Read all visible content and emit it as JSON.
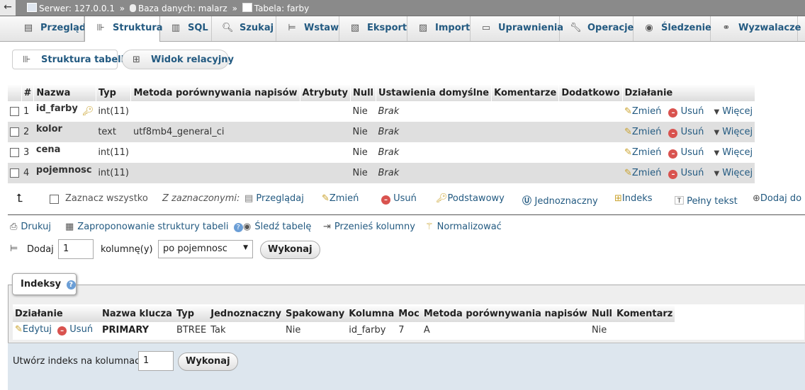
{
  "breadcrumb": {
    "server": "Serwer: 127.0.0.1",
    "database": "Baza danych: malarz",
    "table": "Tabela: farby",
    "sep": "»"
  },
  "tabs": [
    {
      "label": "Przeglądaj",
      "icon": "browse-icon"
    },
    {
      "label": "Struktura",
      "icon": "structure-icon"
    },
    {
      "label": "SQL",
      "icon": "sql-icon"
    },
    {
      "label": "Szukaj",
      "icon": "search-icon"
    },
    {
      "label": "Wstaw",
      "icon": "insert-icon"
    },
    {
      "label": "Eksport",
      "icon": "export-icon"
    },
    {
      "label": "Import",
      "icon": "import-icon"
    },
    {
      "label": "Uprawnienia",
      "icon": "privileges-icon"
    },
    {
      "label": "Operacje",
      "icon": "wrench-icon"
    },
    {
      "label": "Śledzenie",
      "icon": "eye-icon"
    },
    {
      "label": "Wyzwalacze",
      "icon": "triggers-icon"
    }
  ],
  "subtabs": {
    "structure": "Struktura tabeli",
    "relational": "Widok relacyjny"
  },
  "columns_table": {
    "headers": [
      "#",
      "Nazwa",
      "Typ",
      "Metoda porównywania napisów",
      "Atrybuty",
      "Null",
      "Ustawienia domyślne",
      "Komentarze",
      "Dodatkowo",
      "Działanie"
    ],
    "rows": [
      {
        "num": "1",
        "name": "id_farby",
        "type": "int(11)",
        "collation": "",
        "attributes": "",
        "null": "Nie",
        "default": "Brak",
        "comments": "",
        "extra": "",
        "primary": true
      },
      {
        "num": "2",
        "name": "kolor",
        "type": "text",
        "collation": "utf8mb4_general_ci",
        "attributes": "",
        "null": "Nie",
        "default": "Brak",
        "comments": "",
        "extra": "",
        "primary": false
      },
      {
        "num": "3",
        "name": "cena",
        "type": "int(11)",
        "collation": "",
        "attributes": "",
        "null": "Nie",
        "default": "Brak",
        "comments": "",
        "extra": "",
        "primary": false
      },
      {
        "num": "4",
        "name": "pojemnosc",
        "type": "int(11)",
        "collation": "",
        "attributes": "",
        "null": "Nie",
        "default": "Brak",
        "comments": "",
        "extra": "",
        "primary": false
      }
    ],
    "actions": {
      "change": "Zmień",
      "drop": "Usuń",
      "more": "Więcej"
    }
  },
  "selection_bar": {
    "check_all": "Zaznacz wszystko",
    "with_selected": "Z zaznaczonymi:",
    "browse": "Przeglądaj",
    "change": "Zmień",
    "drop": "Usuń",
    "primary": "Podstawowy",
    "unique": "Jednoznaczny",
    "index": "Indeks",
    "fulltext": "Pełny tekst",
    "add_to": "Dodaj do"
  },
  "tools": {
    "print": "Drukuj",
    "propose": "Zaproponowanie struktury tabeli",
    "track": "Śledź tabelę",
    "move": "Przenieś kolumny",
    "normalize": "Normalizować"
  },
  "add_columns": {
    "label": "Dodaj",
    "count": "1",
    "unit": "kolumnę(y)",
    "position": "po pojemnosc",
    "go": "Wykonaj"
  },
  "indexes": {
    "legend": "Indeksy",
    "headers": [
      "Działanie",
      "Nazwa klucza",
      "Typ",
      "Jednoznaczny",
      "Spakowany",
      "Kolumna",
      "Moc",
      "Metoda porównywania napisów",
      "Null",
      "Komentarz"
    ],
    "rows": [
      {
        "edit": "Edytuj",
        "drop": "Usuń",
        "key": "PRIMARY",
        "type": "BTREE",
        "unique": "Tak",
        "packed": "Nie",
        "column": "id_farby",
        "cardinality": "7",
        "collation": "A",
        "null": "Nie",
        "comment": ""
      }
    ],
    "create_label": "Utwórz indeks na kolumnach",
    "create_count": "1",
    "create_go": "Wykonaj"
  },
  "colors": {
    "link": "#235a81",
    "row_alt": "#dfdfdf",
    "footer": "#dde6ee"
  }
}
